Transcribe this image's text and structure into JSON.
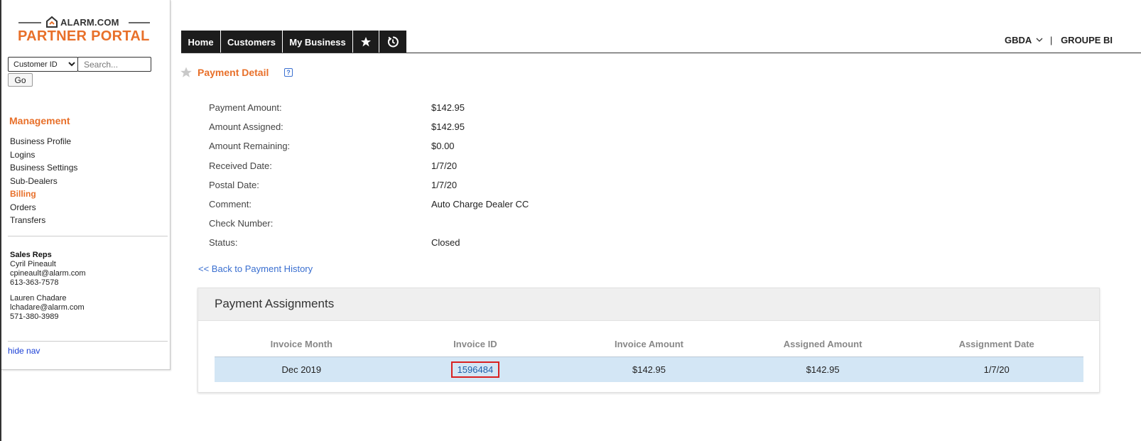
{
  "brand": {
    "company": "ALARM.COM",
    "portal": "PARTNER PORTAL"
  },
  "search": {
    "select_value": "Customer ID",
    "placeholder": "Search...",
    "go_label": "Go"
  },
  "sidebar": {
    "heading": "Management",
    "items": [
      {
        "label": "Business Profile",
        "active": false
      },
      {
        "label": "Logins",
        "active": false
      },
      {
        "label": "Business Settings",
        "active": false
      },
      {
        "label": "Sub-Dealers",
        "active": false
      },
      {
        "label": "Billing",
        "active": true
      },
      {
        "label": "Orders",
        "active": false
      },
      {
        "label": "Transfers",
        "active": false
      }
    ],
    "reps_heading": "Sales Reps",
    "reps": [
      {
        "name": "Cyril Pineault",
        "email": "cpineault@alarm.com",
        "phone": "613-363-7578"
      },
      {
        "name": "Lauren Chadare",
        "email": "lchadare@alarm.com",
        "phone": "571-380-3989"
      }
    ],
    "hide_nav": "hide nav"
  },
  "topnav": {
    "tabs": [
      "Home",
      "Customers",
      "My Business"
    ],
    "star_icon": "star-icon",
    "history_icon": "history-icon",
    "account": "GBDA",
    "separator": "|",
    "company": "GROUPE BI"
  },
  "page": {
    "title": "Payment Detail",
    "help_icon": "?"
  },
  "details": [
    {
      "label": "Payment Amount:",
      "value": "$142.95"
    },
    {
      "label": "Amount Assigned:",
      "value": "$142.95"
    },
    {
      "label": "Amount Remaining:",
      "value": "$0.00"
    },
    {
      "label": "Received Date:",
      "value": "1/7/20"
    },
    {
      "label": "Postal Date:",
      "value": "1/7/20"
    },
    {
      "label": "Comment:",
      "value": "Auto Charge Dealer CC"
    },
    {
      "label": "Check Number:",
      "value": ""
    },
    {
      "label": "Status:",
      "value": "Closed"
    }
  ],
  "back_link": "<< Back to Payment History",
  "assignments": {
    "title": "Payment Assignments",
    "columns": [
      "Invoice Month",
      "Invoice ID",
      "Invoice Amount",
      "Assigned Amount",
      "Assignment Date"
    ],
    "rows": [
      {
        "month": "Dec 2019",
        "invoice_id": "1596484",
        "invoice_amount": "$142.95",
        "assigned_amount": "$142.95",
        "date": "1/7/20"
      }
    ]
  },
  "colors": {
    "accent": "#e8702a",
    "nav_bg": "#1c1c1c",
    "link": "#3a6fd0",
    "row_highlight": "#d3e6f5",
    "invoice_outline": "#d92020"
  }
}
